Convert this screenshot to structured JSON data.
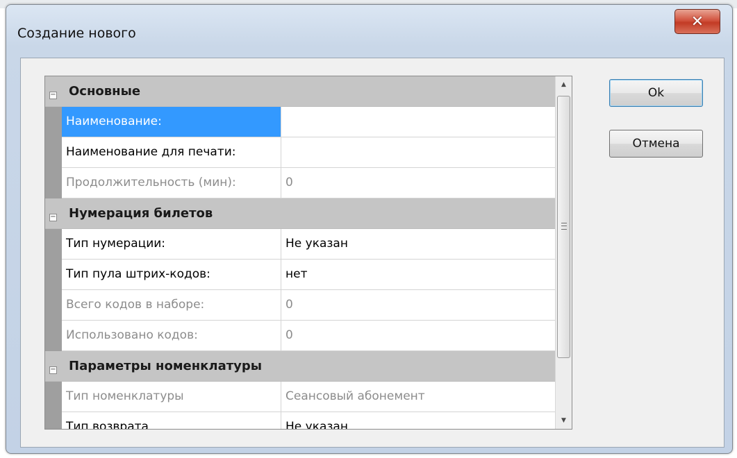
{
  "window": {
    "title": "Создание нового",
    "close_glyph": "✕",
    "close_icon": "close-icon"
  },
  "buttons": {
    "ok_label": "Ok",
    "cancel_label": "Отмена"
  },
  "property_grid": {
    "selected_row": "Наименование:",
    "categories": [
      {
        "label": "Основные",
        "toggle": "−",
        "rows": [
          {
            "name": "Наименование:",
            "value": "",
            "state": "selected"
          },
          {
            "name": "Наименование для печати:",
            "value": "",
            "state": "normal"
          },
          {
            "name": "Продолжительность (мин):",
            "value": "0",
            "state": "disabled"
          }
        ]
      },
      {
        "label": "Нумерация билетов",
        "toggle": "−",
        "rows": [
          {
            "name": "Тип нумерации:",
            "value": "Не указан",
            "state": "normal"
          },
          {
            "name": "Тип пула штрих-кодов:",
            "value": "нет",
            "state": "normal"
          },
          {
            "name": "Всего кодов в наборе:",
            "value": "0",
            "state": "disabled"
          },
          {
            "name": "Использовано кодов:",
            "value": "0",
            "state": "disabled"
          }
        ]
      },
      {
        "label": "Параметры номенклатуры",
        "toggle": "−",
        "rows": [
          {
            "name": "Тип номенклатуры",
            "value": "Сеансовый абонемент",
            "state": "disabled"
          },
          {
            "name": "Тип возврата",
            "value": "Не указан",
            "state": "normal"
          }
        ]
      }
    ]
  },
  "scrollbar": {
    "up_glyph": "▲",
    "down_glyph": "▼"
  },
  "colors": {
    "selection": "#3399ff",
    "category_band": "#c5c5c5",
    "disabled_text": "#8c8c8c"
  }
}
